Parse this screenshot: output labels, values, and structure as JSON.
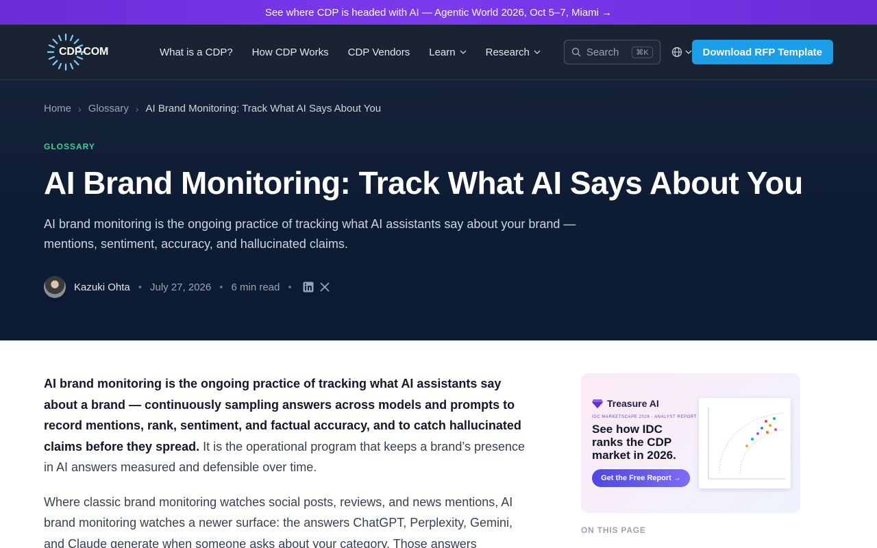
{
  "announcement": {
    "text": "See where CDP is headed with AI — Agentic World 2026, Oct 5–7, Miami →"
  },
  "nav": {
    "logo_text": "CDP.COM",
    "links": [
      {
        "label": "What is a CDP?"
      },
      {
        "label": "How CDP Works"
      },
      {
        "label": "CDP Vendors"
      },
      {
        "label": "Learn"
      },
      {
        "label": "Research"
      }
    ],
    "search_placeholder": "Search",
    "search_shortcut": "⌘K",
    "cta_label": "Download RFP Template"
  },
  "breadcrumb": {
    "items": [
      "Home",
      "Glossary",
      "AI Brand Monitoring: Track What AI Says About You"
    ]
  },
  "hero": {
    "eyebrow": "GLOSSARY",
    "title": "AI Brand Monitoring: Track What AI Says About You",
    "lede": "AI brand monitoring is the ongoing practice of tracking what AI assistants say about your brand — mentions, sentiment, accuracy, and hallucinated claims.",
    "author": "Kazuki Ohta",
    "date": "July 27, 2026",
    "read_time": "6 min read"
  },
  "article": {
    "p1_bold": "AI brand monitoring is the ongoing practice of tracking what AI assistants say about a brand — continuously sampling answers across models and prompts to record mentions, rank, sentiment, and factual accuracy, and to catch hallucinated claims before they spread.",
    "p1_rest": " It is the operational program that keeps a brand’s presence in AI answers measured and defensible over time.",
    "p2": "Where classic brand monitoring watches social posts, reviews, and news mentions, AI brand monitoring watches a newer surface: the answers ChatGPT, Perplexity, Gemini, and Claude generate when someone asks about your category. Those answers"
  },
  "sidebar": {
    "ad": {
      "brand": "Treasure AI",
      "kicker": "IDC MARKETSCAPE 2026 · ANALYST REPORT",
      "headline": "See how IDC ranks the CDP market in 2026.",
      "button": "Get the Free Report →"
    },
    "toc_title": "ON THIS PAGE"
  },
  "colors": {
    "accent": "#1a9ee8",
    "announcement": "#6d28d9",
    "eyebrow": "#34d399"
  }
}
